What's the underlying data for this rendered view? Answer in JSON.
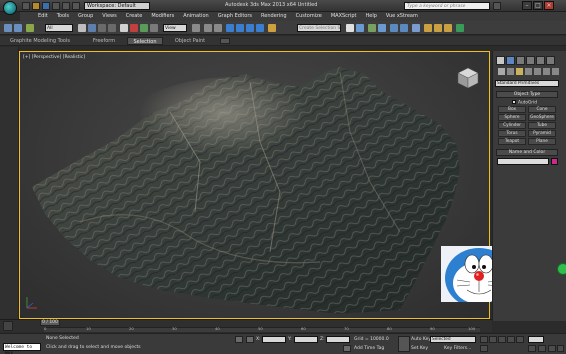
{
  "window": {
    "workspace_label": "Workspace: Default",
    "title": "Autodesk 3ds Max  2013 x64    Untitled",
    "search_placeholder": "Type a keyword or phrase",
    "minimize": "–",
    "maximize": "□",
    "close": "✕"
  },
  "menu": [
    "Edit",
    "Tools",
    "Group",
    "Views",
    "Create",
    "Modifiers",
    "Animation",
    "Graph Editors",
    "Rendering",
    "Customize",
    "MAXScript",
    "Help",
    "Vue xStream"
  ],
  "toolbar": {
    "selection_filter": "All",
    "reference_coord": "View",
    "named_selection_placeholder": "Create Selection Se"
  },
  "ribbon_tabs": [
    "Graphite Modeling Tools",
    "Freeform",
    "Selection",
    "Object Paint"
  ],
  "viewport": {
    "label": "[+] [Perspective] [Realistic]"
  },
  "command_panel": {
    "primitives_dropdown": "Standard Primitives",
    "object_type_header": "Object Type",
    "autogrid_label": "AutoGrid",
    "primitives": [
      "Box",
      "Cone",
      "Sphere",
      "GeoSphere",
      "Cylinder",
      "Tube",
      "Torus",
      "Pyramid",
      "Teapot",
      "Plane"
    ],
    "name_color_header": "Name and Color",
    "accent_color": "#cc2a8a"
  },
  "timeline": {
    "slider_label": "0 / 100",
    "ticks": [
      "0",
      "10",
      "20",
      "30",
      "40",
      "50",
      "60",
      "70",
      "80",
      "90",
      "100"
    ]
  },
  "status": {
    "script_text": "Welcome to MAX",
    "none_selected": "None Selected",
    "prompt": "Click and drag to select and move objects",
    "x_label": "X:",
    "y_label": "Y:",
    "z_label": "Z:",
    "grid": "Grid = 10000.0",
    "add_time_tag": "Add Time Tag",
    "auto_key": "Auto Key",
    "auto_key_mode": "Selected",
    "set_key": "Set Key",
    "key_filters": "Key Filters..."
  }
}
